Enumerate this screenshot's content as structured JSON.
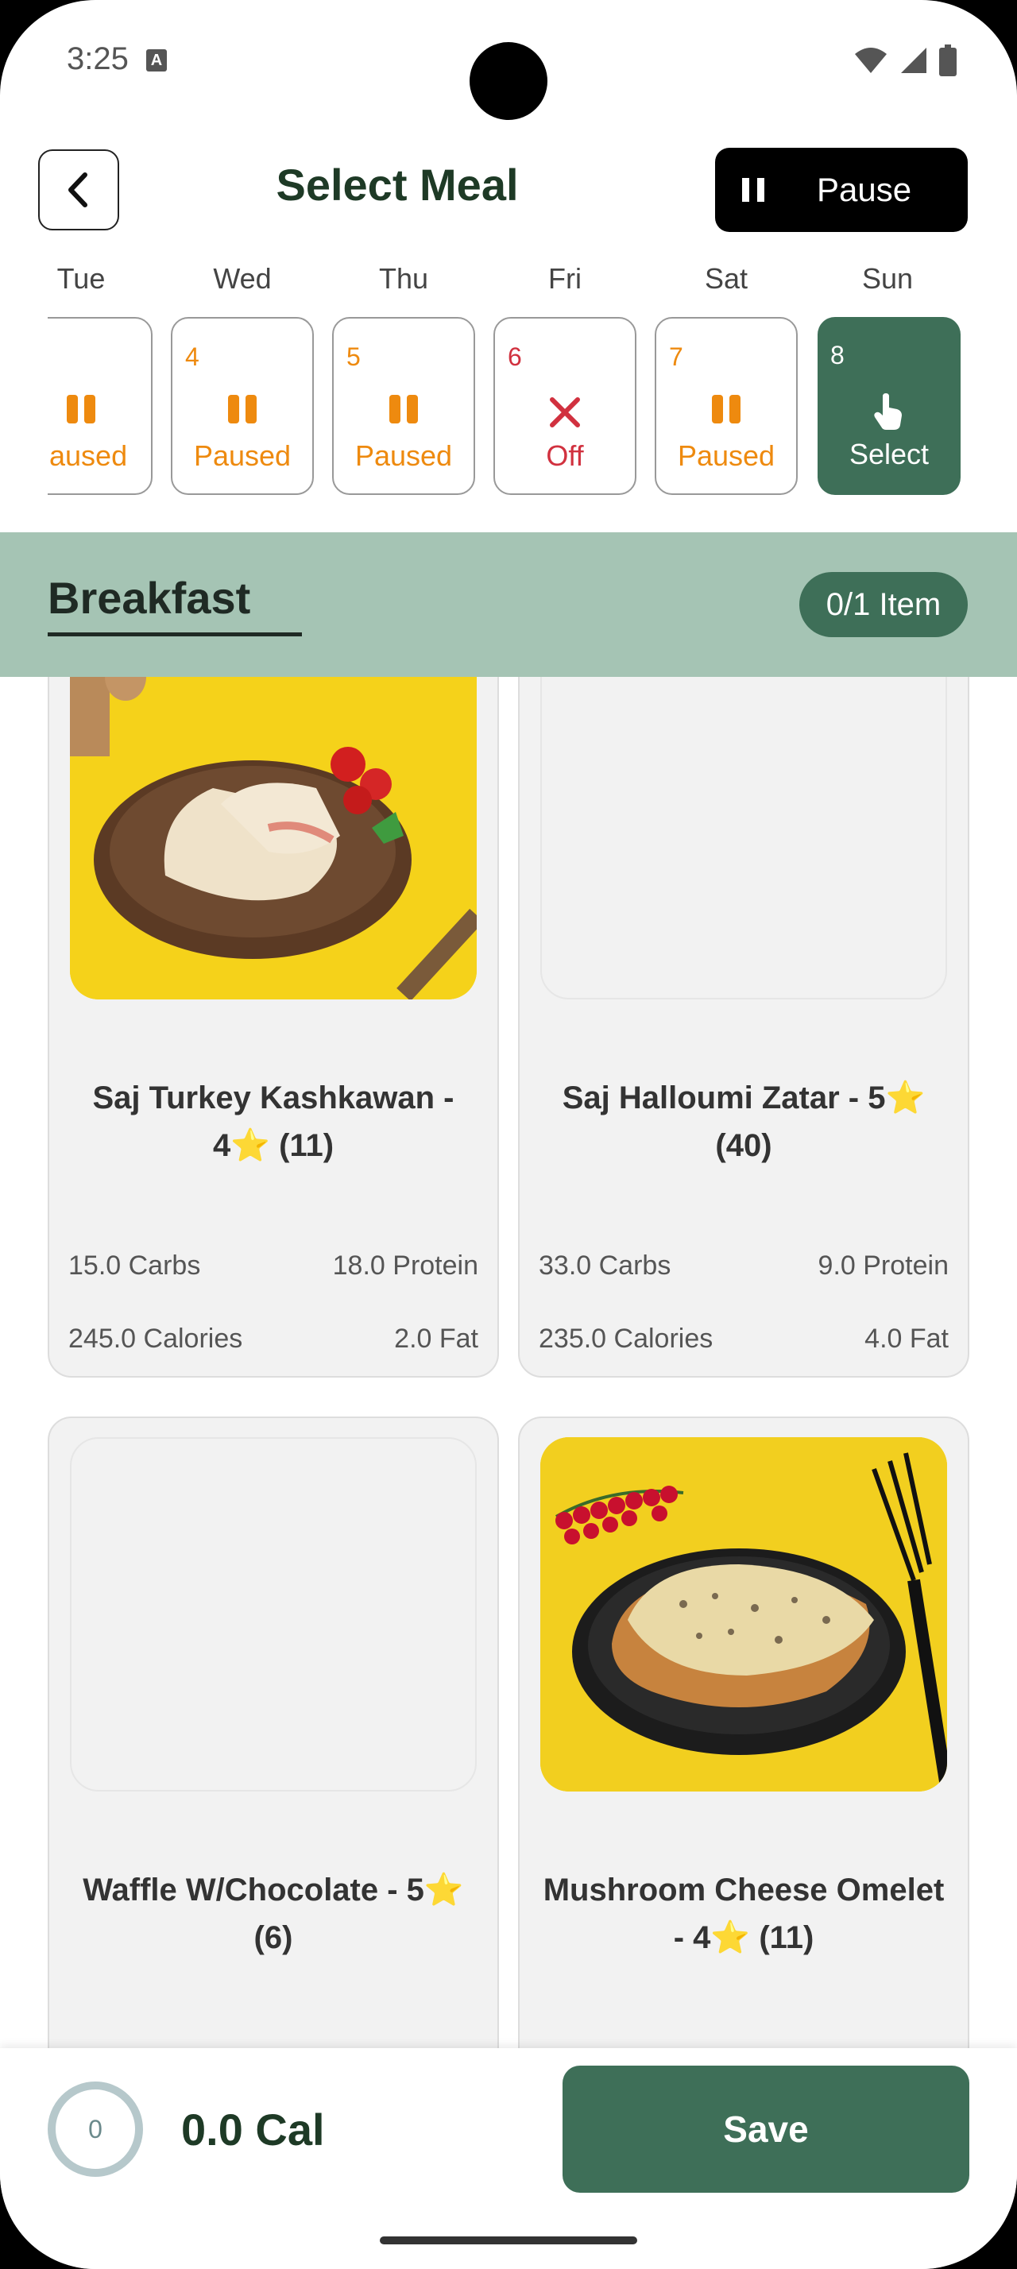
{
  "status_bar": {
    "time": "3:25",
    "input_badge": "A"
  },
  "header": {
    "title": "Select Meal",
    "pause_label": "Pause"
  },
  "days": [
    {
      "name": "Tue",
      "number": "",
      "status": "aused",
      "kind": "paused"
    },
    {
      "name": "Wed",
      "number": "4",
      "status": "Paused",
      "kind": "paused"
    },
    {
      "name": "Thu",
      "number": "5",
      "status": "Paused",
      "kind": "paused"
    },
    {
      "name": "Fri",
      "number": "6",
      "status": "Off",
      "kind": "off"
    },
    {
      "name": "Sat",
      "number": "7",
      "status": "Paused",
      "kind": "paused"
    },
    {
      "name": "Sun",
      "number": "8",
      "status": "Select",
      "kind": "selected"
    }
  ],
  "section": {
    "title": "Breakfast",
    "count": "0/1 Item"
  },
  "meals": [
    {
      "name_line1": "Saj Turkey Kashkawan -",
      "name_line2": "4⭐ (11)",
      "carbs": "15.0 Carbs",
      "protein": "18.0 Protein",
      "calories": "245.0 Calories",
      "fat": "2.0 Fat",
      "image": "wrap-photo"
    },
    {
      "name_line1": "Saj Halloumi Zatar - 5⭐",
      "name_line2": "(40)",
      "carbs": "33.0 Carbs",
      "protein": "9.0 Protein",
      "calories": "235.0 Calories",
      "fat": "4.0 Fat",
      "image": "empty"
    },
    {
      "name_line1": "Waffle W/Chocolate - 5⭐",
      "name_line2": "(6)",
      "image": "empty"
    },
    {
      "name_line1": "Mushroom Cheese Omelet",
      "name_line2": "- 4⭐ (11)",
      "image": "omelet-photo"
    }
  ],
  "footer": {
    "ring_value": "0",
    "calories": "0.0 Cal",
    "save_label": "Save"
  },
  "colors": {
    "primary": "#3e6f58",
    "paused": "#ee8a0f",
    "off": "#d1313f",
    "band": "#a5c4b4"
  }
}
